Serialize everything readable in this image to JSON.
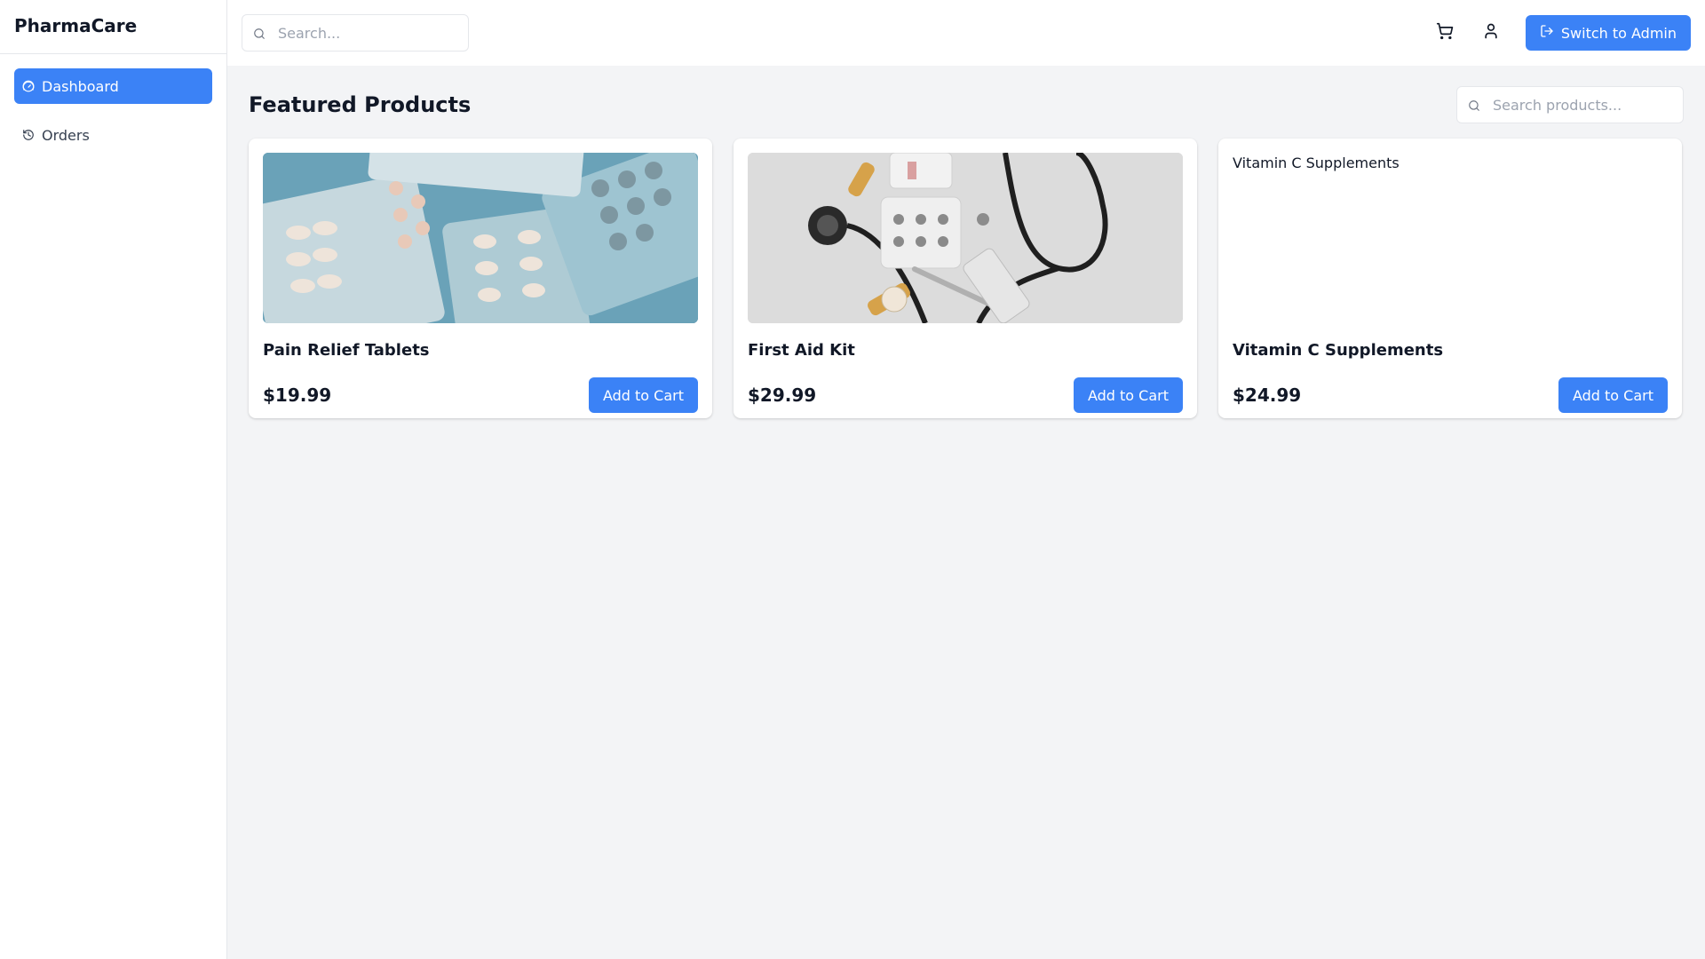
{
  "brand": "PharmaCare",
  "sidebar": {
    "items": [
      {
        "label": "Dashboard",
        "icon": "gauge-icon",
        "active": true
      },
      {
        "label": "Orders",
        "icon": "history-icon",
        "active": false
      }
    ]
  },
  "header": {
    "search_placeholder": "Search...",
    "admin_button_label": "Switch to Admin"
  },
  "main": {
    "title": "Featured Products",
    "search_placeholder": "Search products...",
    "add_to_cart_label": "Add to Cart",
    "products": [
      {
        "name": "Pain Relief Tablets",
        "price": "$19.99",
        "image_loaded": true
      },
      {
        "name": "First Aid Kit",
        "price": "$29.99",
        "image_loaded": true
      },
      {
        "name": "Vitamin C Supplements",
        "price": "$24.99",
        "image_loaded": false,
        "image_alt": "Vitamin C Supplements"
      }
    ]
  },
  "colors": {
    "accent": "#3b82f6",
    "background": "#f3f4f6",
    "card": "#ffffff"
  }
}
